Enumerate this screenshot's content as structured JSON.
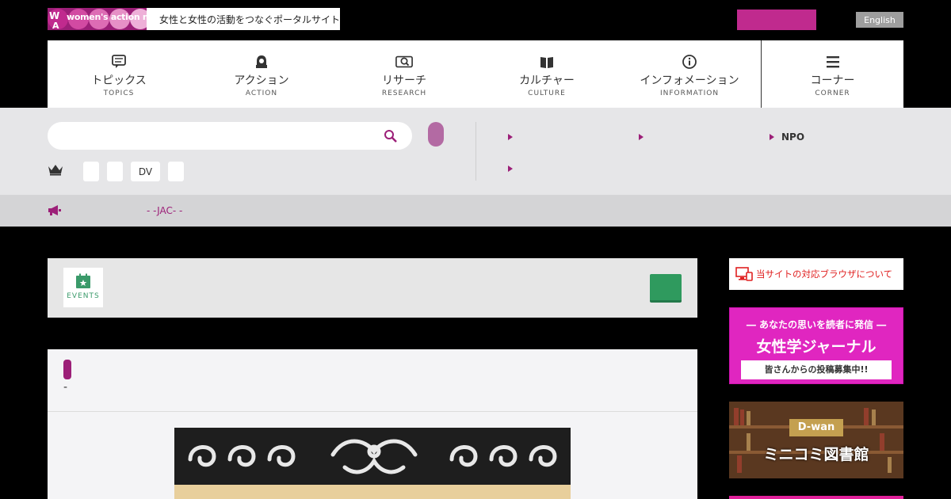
{
  "header": {
    "logo_text": "women's action network",
    "logo_tagline": "女性と女性の活動をつなぐポータルサイト",
    "english_label": "English",
    "colors": {
      "brand": "#9c1f78",
      "accent_pink": "#c02a8e"
    }
  },
  "nav": {
    "items": [
      {
        "ja": "トピックス",
        "en": "TOPICS",
        "icon": "speech-bubble-icon"
      },
      {
        "ja": "アクション",
        "en": "ACTION",
        "icon": "person-icon"
      },
      {
        "ja": "リサーチ",
        "en": "RESEARCH",
        "icon": "magnifier-icon"
      },
      {
        "ja": "カルチャー",
        "en": "CULTURE",
        "icon": "book-icon"
      },
      {
        "ja": "インフォメーション",
        "en": "INFORMATION",
        "icon": "info-icon"
      },
      {
        "ja": "コーナー",
        "en": "CORNER",
        "icon": "menu-icon"
      }
    ]
  },
  "search": {
    "placeholder": "",
    "ranking_tags": [
      "",
      "",
      "DV",
      ""
    ],
    "links": [
      "",
      "",
      "NPO",
      ""
    ]
  },
  "news": {
    "text": "- -JAC- -"
  },
  "events": {
    "label": "EVENTS"
  },
  "article": {
    "subtitle": "-"
  },
  "sidebar": {
    "browser_notice": "当サイトの対応ブラウザについて",
    "journal": {
      "top": "― あなたの思いを読者に発信 ―",
      "main": "女性学ジャーナル",
      "ribbon": "皆さんからの投稿募集中!!"
    },
    "dwan": {
      "tag": "D-wan",
      "main": "ミニコミ図書館"
    }
  }
}
